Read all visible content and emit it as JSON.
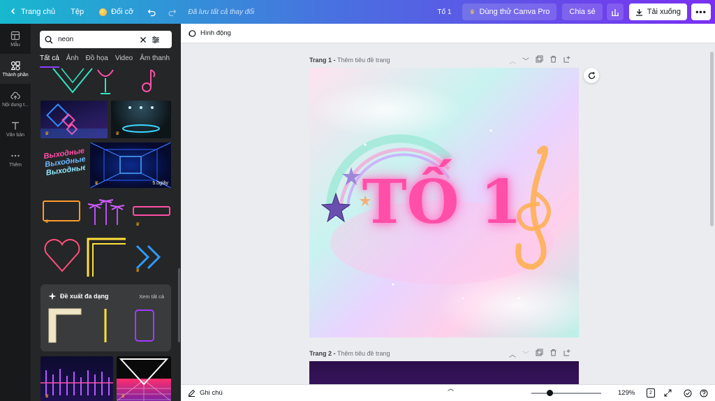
{
  "topbar": {
    "home_label": "Trang chủ",
    "file_label": "Tệp",
    "resize_label": "Đổi cỡ",
    "saved_text": "Đã lưu tất cả thay đổi",
    "doc_title": "Tố 1",
    "pro_label": "Dùng thử Canva Pro",
    "share_label": "Chia sẻ",
    "download_label": "Tải xuống"
  },
  "rail": {
    "items": [
      {
        "label": "Mẫu",
        "icon": "template-icon"
      },
      {
        "label": "Thành phần",
        "icon": "elements-icon"
      },
      {
        "label": "Nội dung t...",
        "icon": "upload-cloud-icon"
      },
      {
        "label": "Văn bản",
        "icon": "text-icon"
      },
      {
        "label": "Thêm",
        "icon": "more-dots-icon"
      }
    ]
  },
  "panel": {
    "search_value": "neon",
    "tabs": [
      "Tất cả",
      "Ảnh",
      "Đồ họa",
      "Video",
      "Âm thanh"
    ],
    "video_duration": "5.0giây",
    "sticker_words": [
      "Выходные",
      "Выходные",
      "Выходные"
    ],
    "suggest_title": "Đề xuất đa dạng",
    "suggest_see_all": "Xem tất cả"
  },
  "editor": {
    "animation_label": "Hình động",
    "page1_label": "Trang 1 - ",
    "page1_sub": "Thêm tiêu đề trang",
    "page2_label": "Trang 2 - ",
    "page2_sub": "Thêm tiêu đề trang",
    "canvas_text": "TỐ 1",
    "notes_label": "Ghi chú",
    "zoom_label": "129%",
    "zoom_fraction": 0.26,
    "page_count": "2"
  },
  "colors": {
    "accent": "#8b3dff",
    "neon_pink": "#ff4fa8",
    "pro_gold": "#f5a623"
  }
}
